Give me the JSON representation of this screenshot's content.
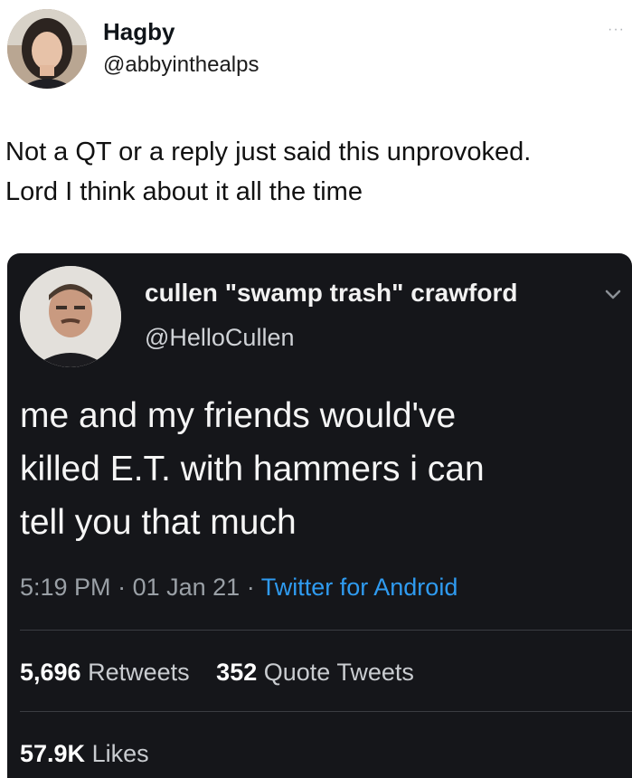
{
  "outer": {
    "name": "Hagby",
    "handle": "@abbyinthealps",
    "more_label": "···",
    "text_line1": "Not a QT or a reply just said this unprovoked.",
    "text_line2": "Lord I think about it all the time"
  },
  "quote": {
    "name": "cullen \"swamp trash\" crawford",
    "handle": "@HelloCullen",
    "text_line1": "me and my friends would've",
    "text_line2": "killed E.T. with hammers i can",
    "text_line3": "tell you that much",
    "time": "5:19 PM",
    "date": "01 Jan 21",
    "separator": "·",
    "source": "Twitter for Android",
    "retweets_count": "5,696",
    "retweets_label": "Retweets",
    "quotes_count": "352",
    "quotes_label": "Quote Tweets",
    "likes_count": "57.9K",
    "likes_label": "Likes"
  },
  "colors": {
    "link": "#2f9bf0",
    "card_bg": "#15161a"
  },
  "icons": {
    "more": "more-dots-icon",
    "chevron": "chevron-down-icon"
  }
}
